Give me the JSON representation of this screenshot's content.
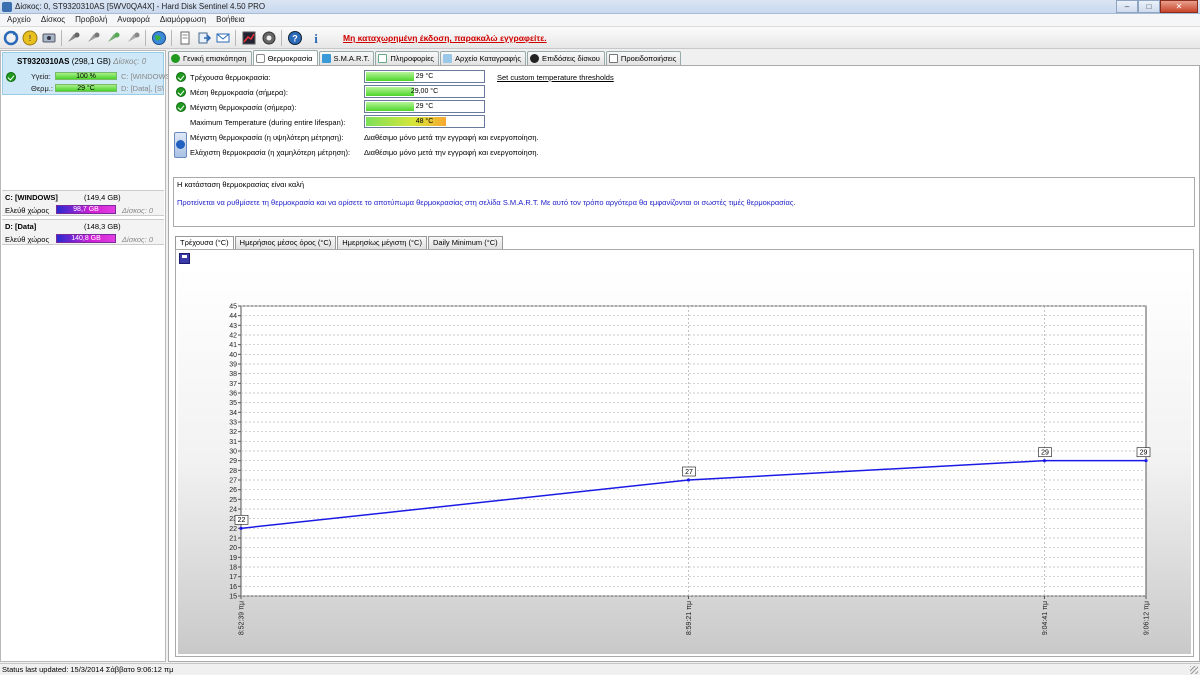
{
  "window": {
    "title": "Δίσκος: 0, ST9320310AS [5WV0QA4X]  -  Hard Disk Sentinel 4.50 PRO",
    "min": "–",
    "max": "□",
    "close": "✕"
  },
  "menu": [
    "Αρχείο",
    "Δίσκος",
    "Προβολή",
    "Αναφορά",
    "Διαμόρφωση",
    "Βοήθεια"
  ],
  "toolbar": {
    "registration_link": "Μη καταχωρημένη έκδοση, παρακαλώ εγγραφείτε."
  },
  "disk": {
    "name": "ST9320310AS",
    "size": "(298,1 GB)",
    "index": "Δίσκος: 0",
    "health_label": "Υγεία:",
    "health_value": "100 %",
    "health_pct": 100,
    "temp_label": "Θερμ.:",
    "temp_value": "29 °C",
    "vol1": "C: [WINDOWS",
    "vol2": "D: [Data],  [S\\"
  },
  "volumes": [
    {
      "name": "C: [WINDOWS]",
      "size": "(149,4 GB)",
      "free_label": "Ελεύθ χώρος",
      "free": "98,7 GB",
      "free_pct": 66,
      "idx": "Δίσκος: 0"
    },
    {
      "name": "D: [Data]",
      "size": "(148,3 GB)",
      "free_label": "Ελεύθ χώρος",
      "free": "140,8 GB",
      "free_pct": 95,
      "idx": "Δίσκος: 0"
    }
  ],
  "tabs": [
    "Γενική επισκόπηση",
    "Θερμοκρασία",
    "S.M.A.R.T.",
    "Πληροφορίες",
    "Αρχείο Καταγραφής",
    "Επιδόσεις δίσκου",
    "Προειδοποιήσεις"
  ],
  "temps": {
    "current_label": "Τρέχουσα θερμοκρασία:",
    "current": "29 °C",
    "avg_label": "Μέση θερμοκρασία (σήμερα):",
    "avg": "29,00 °C",
    "max_label": "Μέγιστη θερμοκρασία (σήμερα):",
    "max": "29 °C",
    "lifetime_label": "Maximum Temperature (during entire lifespan):",
    "lifetime": "48 °C",
    "threshold_link": "Set custom temperature thresholds",
    "hi_label": "Μέγιστη θερμοκρασία (η υψηλότερη μέτρηση):",
    "lo_label": "Ελάχιστη θερμοκρασία (η χαμηλότερη μέτρηση):",
    "na_text": "Διαθέσιμο μόνο μετά την εγγραφή και ενεργοποίηση."
  },
  "status": {
    "line1": "Η κατάσταση θερμοκρασίας είναι καλή",
    "line2": "Προτείνεται να ρυθμίσετε τη θερμοκρασία και να ορίσετε το αποτύπωμα θερμοκρασίας στη σελίδα S.M.A.R.T. Με αυτό τον τρόπο αργότερα θα εμφανίζονται οι σωστές τιμές θερμοκρασίας."
  },
  "subtabs": [
    "Τρέχουσα (°C)",
    "Ημερήσιος μέσος όρος (°C)",
    "Ημερησίως μέγιστη (°C)",
    "Daily Minimum (°C)"
  ],
  "chart_data": {
    "type": "line",
    "x": [
      "8:52:39 πμ",
      "8:59:21 πμ",
      "9:04:41 πμ",
      "9:06:12 πμ"
    ],
    "x_minutes": [
      0,
      6.7,
      12.03,
      13.55
    ],
    "values": [
      22,
      27,
      29,
      29
    ],
    "data_labels": [
      "22",
      "27",
      "29",
      "29"
    ],
    "ylim": [
      15,
      45
    ],
    "yticks": [
      15,
      16,
      17,
      18,
      19,
      20,
      21,
      22,
      23,
      24,
      25,
      26,
      27,
      28,
      29,
      30,
      31,
      32,
      33,
      34,
      35,
      36,
      37,
      38,
      39,
      40,
      41,
      42,
      43,
      44,
      45
    ],
    "grid": true,
    "line_color": "#1a1ae6",
    "title": "",
    "xlabel": "",
    "ylabel": ""
  },
  "statusbar": "Status last updated: 15/3/2014 Σάββατο 9:06:12 πμ"
}
